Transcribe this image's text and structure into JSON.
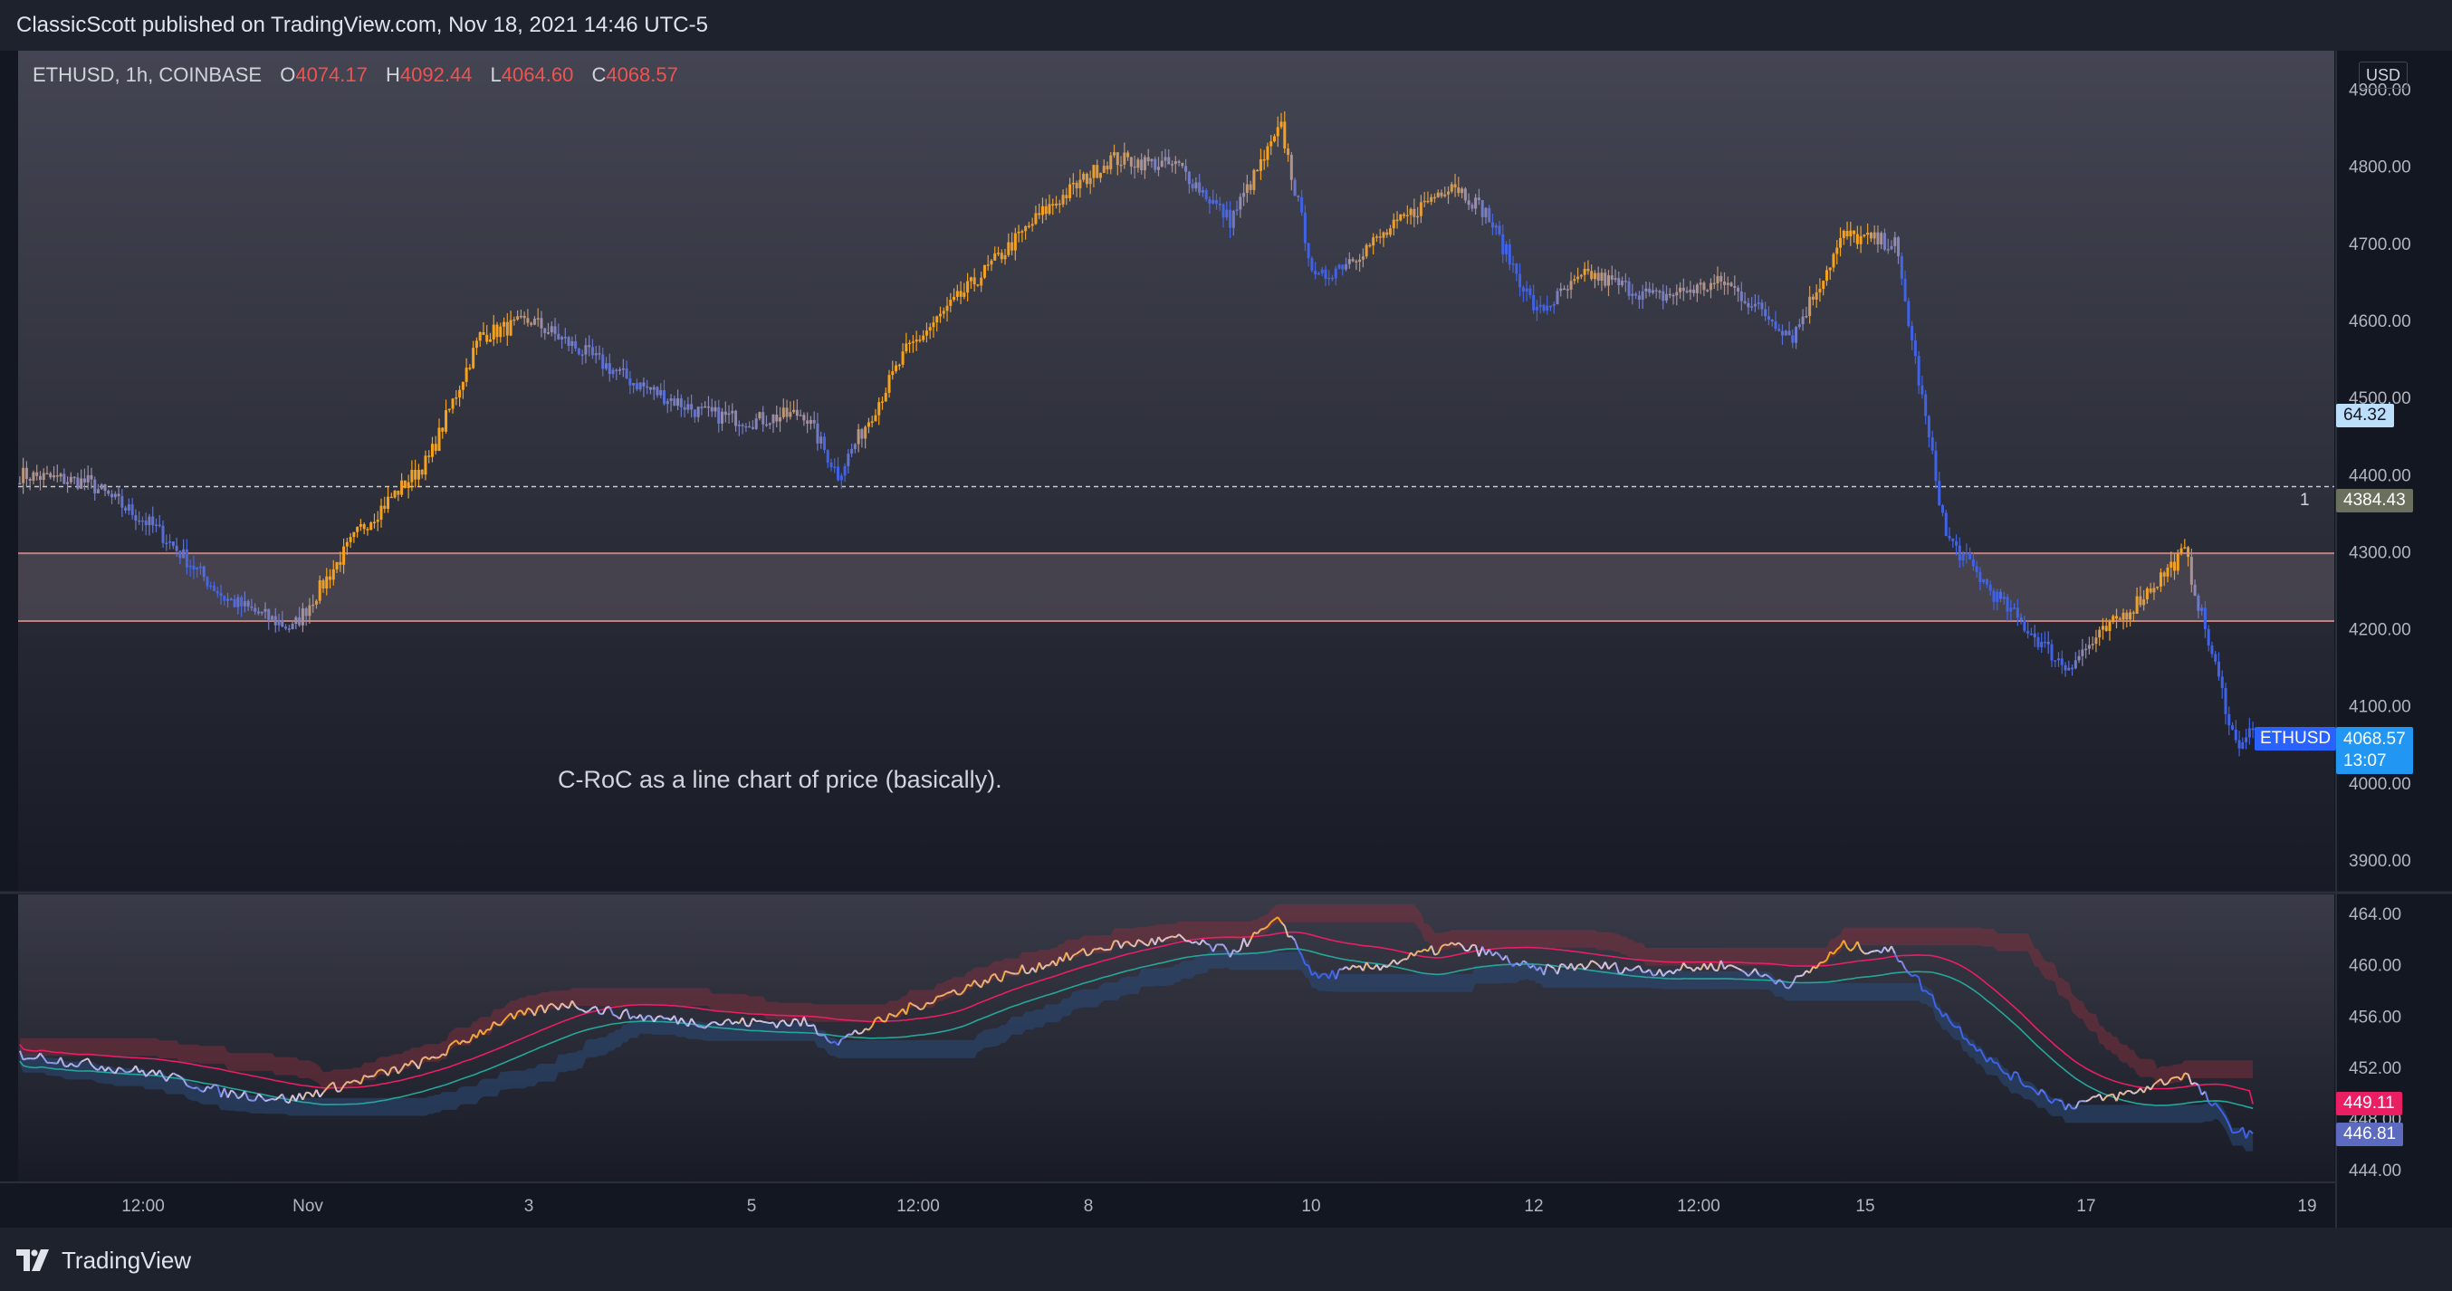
{
  "header": {
    "publish_text": "ClassicScott published on TradingView.com, Nov 18, 2021 14:46 UTC-5"
  },
  "footer": {
    "logo_text": "TradingView"
  },
  "symbol": {
    "name": "ETHUSD, 1h, COINBASE",
    "o_label": "O",
    "o_value": "4074.17",
    "h_label": "H",
    "h_value": "4092.44",
    "l_label": "L",
    "l_value": "4064.60",
    "c_label": "C",
    "c_value": "4068.57",
    "currency": "USD"
  },
  "annotation": "C-RoC as a line chart of price (basically).",
  "tags": {
    "price_alt_value": "64.32",
    "hline_label": "1",
    "hline_value": "4384.43",
    "last_symbol": "ETHUSD",
    "last_price": "4068.57",
    "countdown": "13:07",
    "osc_pink_value": "449.11",
    "osc_blue_value": "446.81"
  },
  "colors": {
    "background": "#131722",
    "bull": "#f7a21b",
    "bear": "#3f62e6",
    "neutral": "#9d90a8",
    "zone": "#5d5560",
    "zone_border": "#c08080",
    "pink_line": "#e91e63",
    "teal_line": "#26a69a",
    "osc_price_line": "#f7a21b"
  },
  "chart_data": [
    {
      "type": "candlestick",
      "title": "ETHUSD, 1h, COINBASE",
      "ylabel": "USD",
      "ylim": [
        3860,
        4950
      ],
      "y_ticks": [
        "4900.00",
        "4800.00",
        "4700.00",
        "4600.00",
        "4500.00",
        "4400.00",
        "4300.00",
        "4200.00",
        "4100.00",
        "4000.00",
        "3900.00"
      ],
      "x_ticks": [
        "12:00",
        "Nov",
        "3",
        "5",
        "12:00",
        "8",
        "10",
        "12",
        "12:00",
        "15",
        "17",
        "19"
      ],
      "support_zone": [
        4210,
        4298
      ],
      "horizontal_line": 4384.43,
      "close_keypoints": [
        [
          0,
          4400
        ],
        [
          20,
          4390
        ],
        [
          40,
          4330
        ],
        [
          60,
          4240
        ],
        [
          80,
          4200
        ],
        [
          100,
          4330
        ],
        [
          120,
          4420
        ],
        [
          135,
          4580
        ],
        [
          150,
          4600
        ],
        [
          165,
          4560
        ],
        [
          180,
          4520
        ],
        [
          200,
          4480
        ],
        [
          215,
          4470
        ],
        [
          230,
          4480
        ],
        [
          240,
          4400
        ],
        [
          260,
          4560
        ],
        [
          280,
          4650
        ],
        [
          300,
          4740
        ],
        [
          320,
          4810
        ],
        [
          340,
          4800
        ],
        [
          355,
          4730
        ],
        [
          370,
          4850
        ],
        [
          380,
          4650
        ],
        [
          400,
          4710
        ],
        [
          420,
          4780
        ],
        [
          430,
          4740
        ],
        [
          445,
          4610
        ],
        [
          460,
          4660
        ],
        [
          480,
          4630
        ],
        [
          500,
          4650
        ],
        [
          520,
          4580
        ],
        [
          535,
          4710
        ],
        [
          550,
          4700
        ],
        [
          565,
          4320
        ],
        [
          580,
          4240
        ],
        [
          600,
          4150
        ],
        [
          620,
          4230
        ],
        [
          635,
          4300
        ],
        [
          650,
          4050
        ],
        [
          655,
          4068.57
        ]
      ],
      "last_close": 4068.57
    },
    {
      "type": "line",
      "title": "C-RoC",
      "ylim": [
        443,
        465.5
      ],
      "y_ticks": [
        "464.00",
        "460.00",
        "456.00",
        "452.00",
        "448.00",
        "444.00"
      ],
      "series": [
        {
          "values_keypoints": [
            [
              0,
              453
            ],
            [
              40,
              451.5
            ],
            [
              60,
              450
            ],
            [
              80,
              449.5
            ],
            [
              100,
              451
            ],
            [
              120,
              452.5
            ],
            [
              140,
              455.5
            ],
            [
              160,
              457
            ],
            [
              180,
              456
            ],
            [
              200,
              455.5
            ],
            [
              230,
              455.5
            ],
            [
              240,
              454
            ],
            [
              260,
              456.5
            ],
            [
              280,
              458.5
            ],
            [
              300,
              460
            ],
            [
              320,
              461.5
            ],
            [
              340,
              462
            ],
            [
              355,
              461
            ],
            [
              370,
              463.5
            ],
            [
              380,
              459
            ],
            [
              400,
              460
            ],
            [
              420,
              461.5
            ],
            [
              430,
              461
            ],
            [
              445,
              459.5
            ],
            [
              460,
              460
            ],
            [
              480,
              459.5
            ],
            [
              500,
              460
            ],
            [
              520,
              458.5
            ],
            [
              535,
              461.5
            ],
            [
              550,
              461
            ],
            [
              565,
              456
            ],
            [
              580,
              452
            ],
            [
              600,
              449
            ],
            [
              620,
              450
            ],
            [
              635,
              451.5
            ],
            [
              650,
              447
            ],
            [
              655,
              446.81
            ]
          ]
        },
        {
          "last": 449.11
        },
        {
          "last": 446.81
        }
      ]
    }
  ]
}
